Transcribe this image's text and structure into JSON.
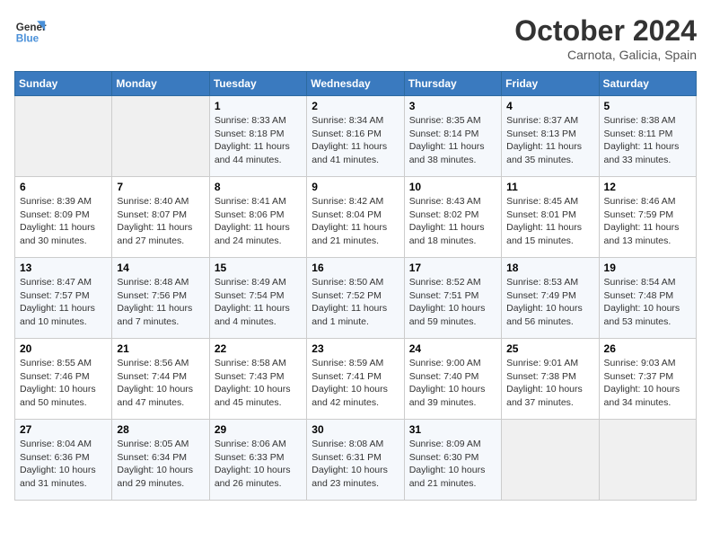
{
  "header": {
    "logo_line1": "General",
    "logo_line2": "Blue",
    "month": "October 2024",
    "location": "Carnota, Galicia, Spain"
  },
  "weekdays": [
    "Sunday",
    "Monday",
    "Tuesday",
    "Wednesday",
    "Thursday",
    "Friday",
    "Saturday"
  ],
  "weeks": [
    [
      {
        "day": "",
        "info": ""
      },
      {
        "day": "",
        "info": ""
      },
      {
        "day": "1",
        "info": "Sunrise: 8:33 AM\nSunset: 8:18 PM\nDaylight: 11 hours and 44 minutes."
      },
      {
        "day": "2",
        "info": "Sunrise: 8:34 AM\nSunset: 8:16 PM\nDaylight: 11 hours and 41 minutes."
      },
      {
        "day": "3",
        "info": "Sunrise: 8:35 AM\nSunset: 8:14 PM\nDaylight: 11 hours and 38 minutes."
      },
      {
        "day": "4",
        "info": "Sunrise: 8:37 AM\nSunset: 8:13 PM\nDaylight: 11 hours and 35 minutes."
      },
      {
        "day": "5",
        "info": "Sunrise: 8:38 AM\nSunset: 8:11 PM\nDaylight: 11 hours and 33 minutes."
      }
    ],
    [
      {
        "day": "6",
        "info": "Sunrise: 8:39 AM\nSunset: 8:09 PM\nDaylight: 11 hours and 30 minutes."
      },
      {
        "day": "7",
        "info": "Sunrise: 8:40 AM\nSunset: 8:07 PM\nDaylight: 11 hours and 27 minutes."
      },
      {
        "day": "8",
        "info": "Sunrise: 8:41 AM\nSunset: 8:06 PM\nDaylight: 11 hours and 24 minutes."
      },
      {
        "day": "9",
        "info": "Sunrise: 8:42 AM\nSunset: 8:04 PM\nDaylight: 11 hours and 21 minutes."
      },
      {
        "day": "10",
        "info": "Sunrise: 8:43 AM\nSunset: 8:02 PM\nDaylight: 11 hours and 18 minutes."
      },
      {
        "day": "11",
        "info": "Sunrise: 8:45 AM\nSunset: 8:01 PM\nDaylight: 11 hours and 15 minutes."
      },
      {
        "day": "12",
        "info": "Sunrise: 8:46 AM\nSunset: 7:59 PM\nDaylight: 11 hours and 13 minutes."
      }
    ],
    [
      {
        "day": "13",
        "info": "Sunrise: 8:47 AM\nSunset: 7:57 PM\nDaylight: 11 hours and 10 minutes."
      },
      {
        "day": "14",
        "info": "Sunrise: 8:48 AM\nSunset: 7:56 PM\nDaylight: 11 hours and 7 minutes."
      },
      {
        "day": "15",
        "info": "Sunrise: 8:49 AM\nSunset: 7:54 PM\nDaylight: 11 hours and 4 minutes."
      },
      {
        "day": "16",
        "info": "Sunrise: 8:50 AM\nSunset: 7:52 PM\nDaylight: 11 hours and 1 minute."
      },
      {
        "day": "17",
        "info": "Sunrise: 8:52 AM\nSunset: 7:51 PM\nDaylight: 10 hours and 59 minutes."
      },
      {
        "day": "18",
        "info": "Sunrise: 8:53 AM\nSunset: 7:49 PM\nDaylight: 10 hours and 56 minutes."
      },
      {
        "day": "19",
        "info": "Sunrise: 8:54 AM\nSunset: 7:48 PM\nDaylight: 10 hours and 53 minutes."
      }
    ],
    [
      {
        "day": "20",
        "info": "Sunrise: 8:55 AM\nSunset: 7:46 PM\nDaylight: 10 hours and 50 minutes."
      },
      {
        "day": "21",
        "info": "Sunrise: 8:56 AM\nSunset: 7:44 PM\nDaylight: 10 hours and 47 minutes."
      },
      {
        "day": "22",
        "info": "Sunrise: 8:58 AM\nSunset: 7:43 PM\nDaylight: 10 hours and 45 minutes."
      },
      {
        "day": "23",
        "info": "Sunrise: 8:59 AM\nSunset: 7:41 PM\nDaylight: 10 hours and 42 minutes."
      },
      {
        "day": "24",
        "info": "Sunrise: 9:00 AM\nSunset: 7:40 PM\nDaylight: 10 hours and 39 minutes."
      },
      {
        "day": "25",
        "info": "Sunrise: 9:01 AM\nSunset: 7:38 PM\nDaylight: 10 hours and 37 minutes."
      },
      {
        "day": "26",
        "info": "Sunrise: 9:03 AM\nSunset: 7:37 PM\nDaylight: 10 hours and 34 minutes."
      }
    ],
    [
      {
        "day": "27",
        "info": "Sunrise: 8:04 AM\nSunset: 6:36 PM\nDaylight: 10 hours and 31 minutes."
      },
      {
        "day": "28",
        "info": "Sunrise: 8:05 AM\nSunset: 6:34 PM\nDaylight: 10 hours and 29 minutes."
      },
      {
        "day": "29",
        "info": "Sunrise: 8:06 AM\nSunset: 6:33 PM\nDaylight: 10 hours and 26 minutes."
      },
      {
        "day": "30",
        "info": "Sunrise: 8:08 AM\nSunset: 6:31 PM\nDaylight: 10 hours and 23 minutes."
      },
      {
        "day": "31",
        "info": "Sunrise: 8:09 AM\nSunset: 6:30 PM\nDaylight: 10 hours and 21 minutes."
      },
      {
        "day": "",
        "info": ""
      },
      {
        "day": "",
        "info": ""
      }
    ]
  ]
}
